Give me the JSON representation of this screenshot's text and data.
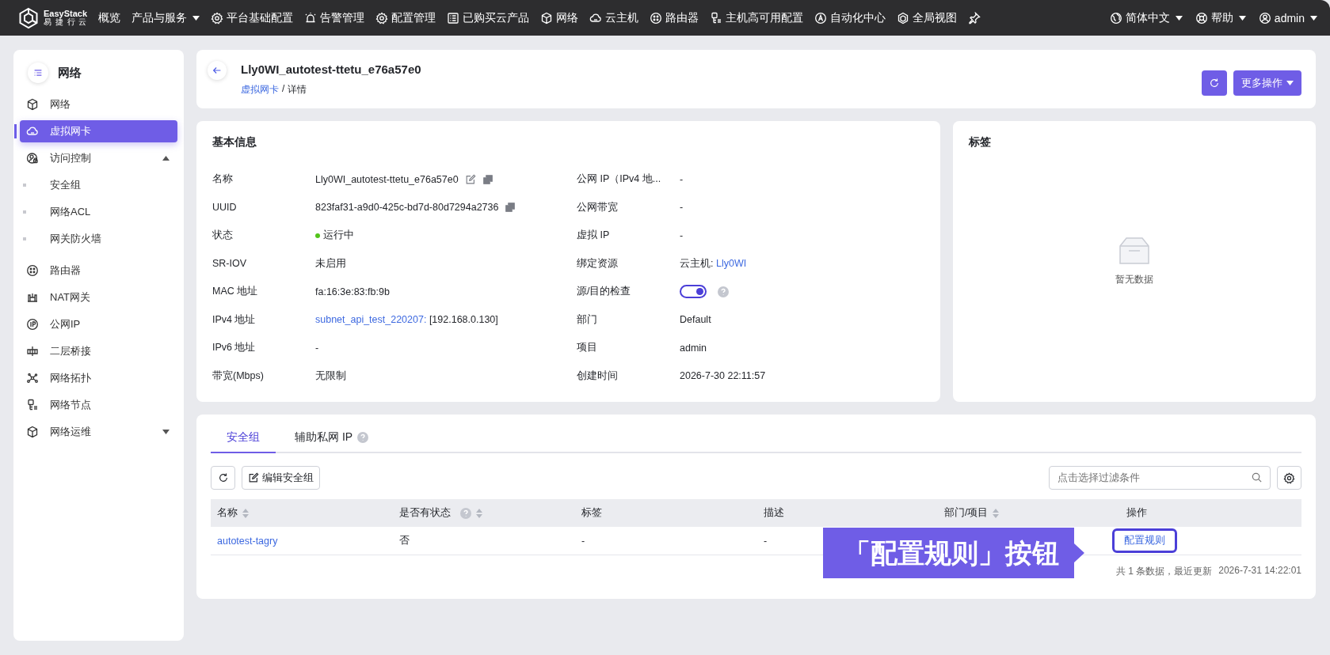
{
  "topbar": {
    "logo": {
      "name": "EasyStack",
      "sub": "易 捷 行 云"
    },
    "nav": [
      {
        "label": "概览",
        "dropdown": false
      },
      {
        "label": "产品与服务",
        "dropdown": true
      },
      {
        "label": "平台基础配置",
        "dropdown": false
      },
      {
        "label": "告警管理",
        "dropdown": false
      },
      {
        "label": "配置管理",
        "dropdown": false
      },
      {
        "label": "已购买云产品",
        "dropdown": false
      },
      {
        "label": "网络",
        "dropdown": false
      },
      {
        "label": "云主机",
        "dropdown": false
      },
      {
        "label": "路由器",
        "dropdown": false
      },
      {
        "label": "主机高可用配置",
        "dropdown": false
      },
      {
        "label": "自动化中心",
        "dropdown": false
      },
      {
        "label": "全局视图",
        "dropdown": false
      }
    ],
    "right": [
      {
        "label": "简体中文",
        "dropdown": true
      },
      {
        "label": "帮助",
        "dropdown": true
      },
      {
        "label": "admin",
        "dropdown": true
      }
    ]
  },
  "sidebar": {
    "title": "网络",
    "items": [
      {
        "label": "网络",
        "selected": false
      },
      {
        "label": "虚拟网卡",
        "selected": true
      },
      {
        "label": "访问控制",
        "selected": false,
        "expanded": true,
        "children": [
          {
            "label": "安全组",
            "selected": false
          },
          {
            "label": "网络ACL",
            "selected": false
          },
          {
            "label": "网关防火墙",
            "selected": false
          }
        ]
      },
      {
        "label": "路由器",
        "selected": false
      },
      {
        "label": "NAT网关",
        "selected": false
      },
      {
        "label": "公网IP",
        "selected": false
      },
      {
        "label": "二层桥接",
        "selected": false
      },
      {
        "label": "网络拓扑",
        "selected": false
      },
      {
        "label": "网络节点",
        "selected": false
      },
      {
        "label": "网络运维",
        "selected": false,
        "expanded": false
      }
    ]
  },
  "header": {
    "title": "Lly0WI_autotest-ttetu_e76a57e0",
    "breadcrumb": [
      {
        "label": "虚拟网卡",
        "link": true
      },
      {
        "label": "详情",
        "link": false
      }
    ],
    "separator": "/",
    "more_button": "更多操作"
  },
  "info": {
    "title": "基本信息",
    "rows": [
      [
        {
          "label": "名称",
          "kind": "text",
          "value": "Lly0WI_autotest-ttetu_e76a57e0",
          "editable": true,
          "copyable": true
        },
        {
          "label": "公网 IP（IPv4 地...",
          "kind": "text",
          "value": "-"
        }
      ],
      [
        {
          "label": "UUID",
          "kind": "text",
          "value": "823faf31-a9d0-425c-bd7d-80d7294a2736",
          "copyable": true
        },
        {
          "label": "公网带宽",
          "kind": "text",
          "value": "-"
        }
      ],
      [
        {
          "label": "状态",
          "kind": "status",
          "value": "运行中",
          "color": "#52c41a"
        },
        {
          "label": "虚拟 IP",
          "kind": "text",
          "value": "-"
        }
      ],
      [
        {
          "label": "SR-IOV",
          "kind": "text",
          "value": "未启用"
        },
        {
          "label": "绑定资源",
          "kind": "link",
          "prefix": "云主机: ",
          "value": "Lly0WI"
        }
      ],
      [
        {
          "label": "MAC 地址",
          "kind": "text",
          "value": "fa:16:3e:83:fb:9b"
        },
        {
          "label": "源/目的检查",
          "kind": "toggle",
          "on": true,
          "help": true
        }
      ],
      [
        {
          "label": "IPv4 地址",
          "kind": "link",
          "value": "subnet_api_test_220207:",
          "suffix": " [192.168.0.130]"
        },
        {
          "label": "部门",
          "kind": "text",
          "value": "Default"
        }
      ],
      [
        {
          "label": "IPv6 地址",
          "kind": "text",
          "value": "-"
        },
        {
          "label": "项目",
          "kind": "text",
          "value": "admin"
        }
      ],
      [
        {
          "label": "带宽(Mbps)",
          "kind": "text",
          "value": "无限制"
        },
        {
          "label": "创建时间",
          "kind": "text",
          "value": "2026-7-30 22:11:57"
        }
      ]
    ]
  },
  "tags": {
    "title": "标签",
    "empty_text": "暂无数据"
  },
  "tabs": [
    {
      "label": "安全组",
      "selected": true,
      "help": false
    },
    {
      "label": "辅助私网 IP",
      "selected": false,
      "help": true
    }
  ],
  "toolbar": {
    "edit_button": "编辑安全组",
    "search": {
      "placeholder": "点击选择过滤条件"
    }
  },
  "table": {
    "columns": [
      {
        "label": "名称",
        "sortable": true,
        "help": false
      },
      {
        "label": "是否有状态",
        "sortable": true,
        "help": true
      },
      {
        "label": "标签",
        "sortable": false,
        "help": false
      },
      {
        "label": "描述",
        "sortable": false,
        "help": false
      },
      {
        "label": "部门/项目",
        "sortable": true,
        "help": false
      },
      {
        "label": "操作",
        "sortable": false,
        "help": false
      }
    ],
    "rows": [
      {
        "name": "autotest-tagry",
        "stateful": "否",
        "tags": "-",
        "description": "-",
        "action": {
          "label": "配置规则",
          "highlighted": true
        }
      }
    ]
  },
  "footer": {
    "count": "共 1 条数据，最近更新",
    "updated": "2026-7-31 14:22:01"
  },
  "callout": {
    "text": "「配置规则」按钮"
  }
}
